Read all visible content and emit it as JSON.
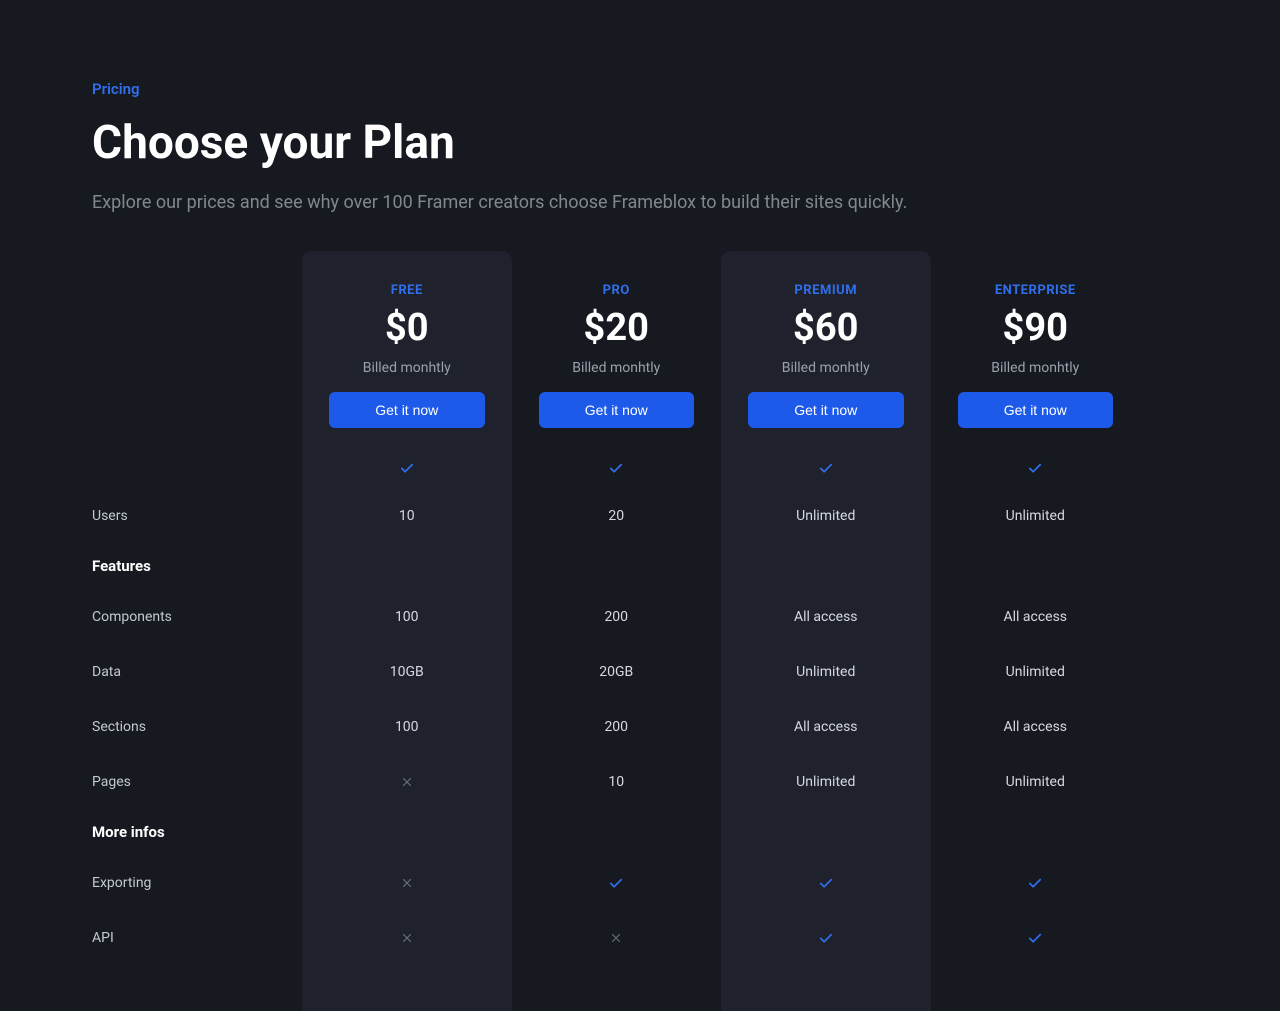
{
  "header": {
    "eyebrow": "Pricing",
    "title": "Choose your Plan",
    "subtitle": "Explore our prices and see why over 100 Framer creators choose Frameblox to build their sites quickly."
  },
  "plans": [
    {
      "name": "FREE",
      "price": "$0",
      "billing": "Billed monhtly",
      "cta": "Get it now"
    },
    {
      "name": "PRO",
      "price": "$20",
      "billing": "Billed monhtly",
      "cta": "Get it now"
    },
    {
      "name": "PREMIUM",
      "price": "$60",
      "billing": "Billed monhtly",
      "cta": "Get it now"
    },
    {
      "name": "ENTERPRISE",
      "price": "$90",
      "billing": "Billed monhtly",
      "cta": "Get it now"
    }
  ],
  "sections": [
    {
      "title": "",
      "rows": [
        {
          "label": "",
          "values": [
            "check",
            "check",
            "check",
            "check"
          ],
          "firstRow": true
        },
        {
          "label": "Users",
          "values": [
            "10",
            "20",
            "Unlimited",
            "Unlimited"
          ]
        }
      ]
    },
    {
      "title": "Features",
      "rows": [
        {
          "label": "Components",
          "values": [
            "100",
            "200",
            "All access",
            "All access"
          ]
        },
        {
          "label": "Data",
          "values": [
            "10GB",
            "20GB",
            "Unlimited",
            "Unlimited"
          ]
        },
        {
          "label": "Sections",
          "values": [
            "100",
            "200",
            "All access",
            "All access"
          ]
        },
        {
          "label": "Pages",
          "values": [
            "cross",
            "10",
            "Unlimited",
            "Unlimited"
          ]
        }
      ]
    },
    {
      "title": "More infos",
      "rows": [
        {
          "label": "Exporting",
          "values": [
            "cross",
            "check",
            "check",
            "check"
          ]
        },
        {
          "label": "API",
          "values": [
            "cross",
            "cross",
            "check",
            "check"
          ]
        }
      ]
    }
  ]
}
